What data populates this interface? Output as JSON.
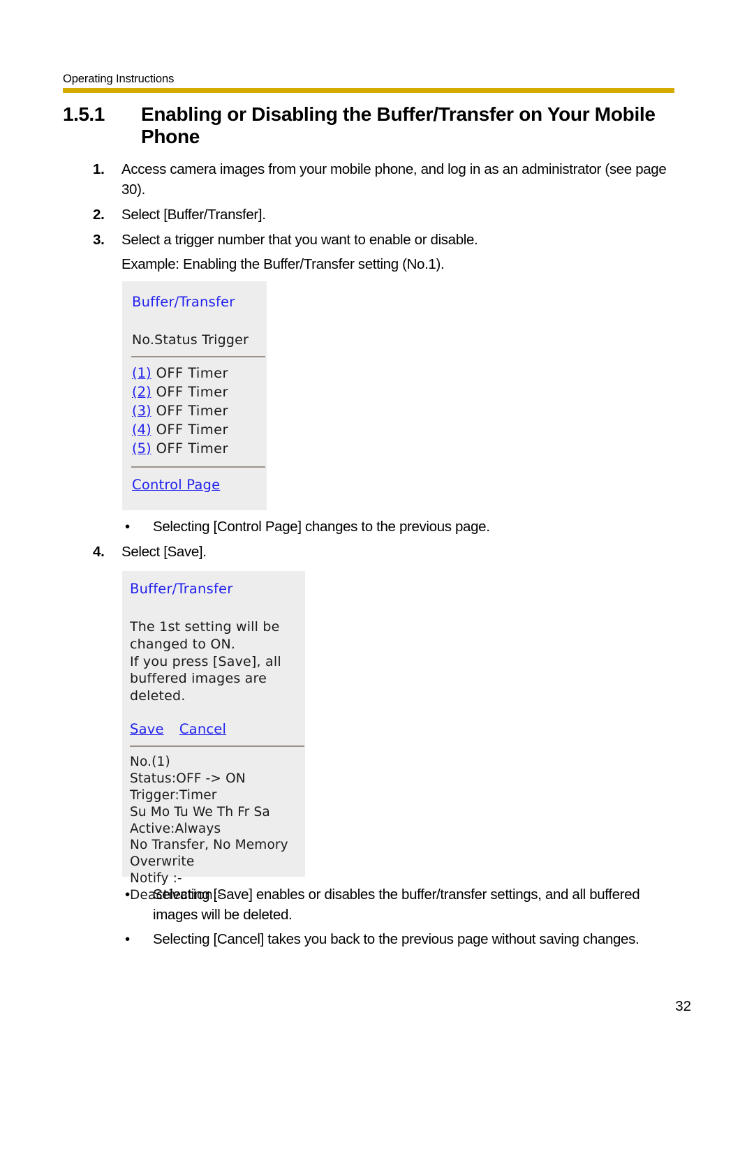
{
  "document": {
    "running_header": "Operating Instructions",
    "page_number": "32",
    "accent_color": "#d6ab00"
  },
  "section": {
    "number": "1.5.1",
    "title": "Enabling or Disabling the Buffer/Transfer on Your Mobile Phone"
  },
  "steps": [
    {
      "number": "1.",
      "text": "Access camera images from your mobile phone, and log in as an administrator (see page 30)."
    },
    {
      "number": "2.",
      "text": "Select [Buffer/Transfer]."
    },
    {
      "number": "3.",
      "text": "Select a trigger number that you want to enable or disable.",
      "sub": "Example: Enabling the Buffer/Transfer setting (No.1)."
    },
    {
      "number": "4.",
      "text": "Select [Save]."
    }
  ],
  "capture_list": {
    "title": "Buffer/Transfer",
    "table_header": "No.Status Trigger",
    "rows": [
      {
        "index": "(1)",
        "status_trigger": "OFF Timer"
      },
      {
        "index": "(2)",
        "status_trigger": "OFF Timer"
      },
      {
        "index": "(3)",
        "status_trigger": "OFF Timer"
      },
      {
        "index": "(4)",
        "status_trigger": "OFF Timer"
      },
      {
        "index": "(5)",
        "status_trigger": "OFF Timer"
      }
    ],
    "control_page_link": "Control Page"
  },
  "capture_confirm": {
    "title": "Buffer/Transfer",
    "message_lines": [
      "The 1st setting will be",
      "changed to ON.",
      "If you press [Save], all",
      "buffered images are deleted."
    ],
    "save_link": "Save",
    "cancel_link": "Cancel",
    "details": [
      "No.(1)",
      "Status:OFF -> ON",
      "Trigger:Timer",
      "Su Mo Tu We Th Fr Sa",
      "Active:Always",
      "No Transfer, No Memory",
      "Overwrite",
      "Notify  :-",
      "Deactivation:-"
    ]
  },
  "bullets_after_list": [
    {
      "dot": "•",
      "text": "Selecting [Control Page] changes to the previous page."
    }
  ],
  "bullets_after_confirm": [
    {
      "dot": "•",
      "text": "Selecting [Save] enables or disables the buffer/transfer settings, and all buffered images will be deleted."
    },
    {
      "dot": "•",
      "text": "Selecting [Cancel] takes you back to the previous page without saving changes."
    }
  ]
}
